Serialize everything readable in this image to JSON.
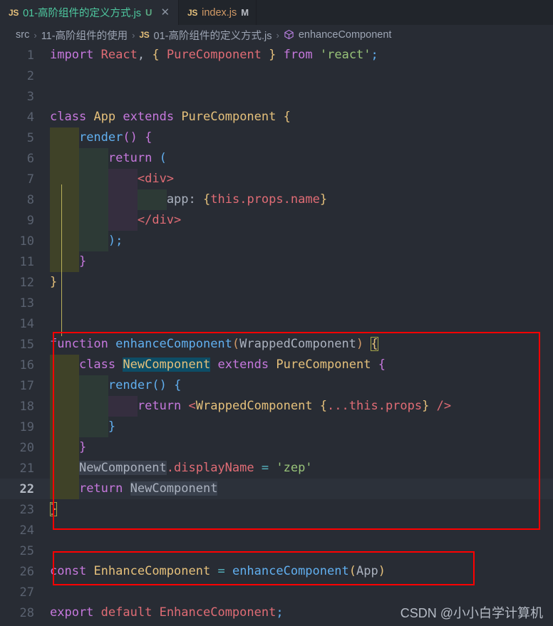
{
  "tabs": [
    {
      "icon": "js-file-icon",
      "icon_label": "JS",
      "label": "01-高阶组件的定义方式.js",
      "badge": "U",
      "close": "✕",
      "state": "active"
    },
    {
      "icon": "js-file-icon",
      "icon_label": "JS",
      "label": "index.js",
      "badge": "M",
      "close": "",
      "state": "inactive"
    }
  ],
  "breadcrumb": {
    "items": [
      "src",
      "11-高阶组件的使用",
      "01-高阶组件的定义方式.js",
      "enhanceComponent"
    ],
    "separator": "›",
    "file_icon_label": "JS",
    "symbol_icon": "cube-icon"
  },
  "editor": {
    "active_line": 22,
    "lines": [
      {
        "n": 1,
        "text": "import React, { PureComponent } from 'react';"
      },
      {
        "n": 2,
        "text": ""
      },
      {
        "n": 3,
        "text": ""
      },
      {
        "n": 4,
        "text": "class App extends PureComponent {"
      },
      {
        "n": 5,
        "text": "    render() {"
      },
      {
        "n": 6,
        "text": "        return ("
      },
      {
        "n": 7,
        "text": "            <div>"
      },
      {
        "n": 8,
        "text": "                app: {this.props.name}"
      },
      {
        "n": 9,
        "text": "            </div>"
      },
      {
        "n": 10,
        "text": "        );"
      },
      {
        "n": 11,
        "text": "    }"
      },
      {
        "n": 12,
        "text": "}"
      },
      {
        "n": 13,
        "text": ""
      },
      {
        "n": 14,
        "text": ""
      },
      {
        "n": 15,
        "text": "function enhanceComponent(WrappedComponent) {"
      },
      {
        "n": 16,
        "text": "    class NewComponent extends PureComponent {"
      },
      {
        "n": 17,
        "text": "        render() {"
      },
      {
        "n": 18,
        "text": "            return <WrappedComponent {...this.props} />"
      },
      {
        "n": 19,
        "text": "        }"
      },
      {
        "n": 20,
        "text": "    }"
      },
      {
        "n": 21,
        "text": "    NewComponent.displayName = 'zep'"
      },
      {
        "n": 22,
        "text": "    return NewComponent"
      },
      {
        "n": 23,
        "text": "}"
      },
      {
        "n": 24,
        "text": ""
      },
      {
        "n": 25,
        "text": ""
      },
      {
        "n": 26,
        "text": "const EnhanceComponent = enhanceComponent(App)"
      },
      {
        "n": 27,
        "text": ""
      },
      {
        "n": 28,
        "text": "export default EnhanceComponent;"
      }
    ]
  },
  "annotations": {
    "boxes": [
      {
        "name": "enhance-component-function-box",
        "lines": "15-23"
      },
      {
        "name": "const-enhance-component-box",
        "lines": "26"
      }
    ],
    "box_color": "#ff0000"
  },
  "watermark": {
    "text": "CSDN @小小白学计算机"
  },
  "colors": {
    "editor_background": "#282c34",
    "tabbar_background": "#21252b",
    "active_tab_background": "#282c34",
    "keyword": "#c678dd",
    "function": "#61afef",
    "string": "#98c379",
    "type": "#e5c07b",
    "variable": "#e06c75",
    "operator": "#56b6c2",
    "line_number": "#5a6270",
    "annotation_red": "#ff0000"
  }
}
